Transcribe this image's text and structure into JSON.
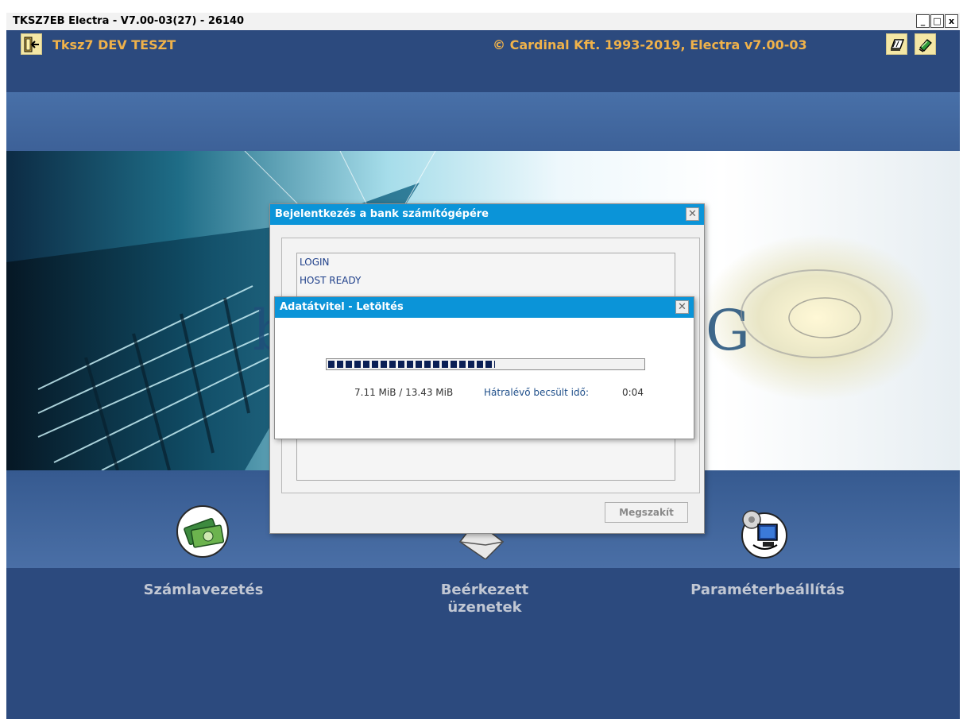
{
  "window": {
    "title": "TKSZ7EB Electra - V7.00-03(27) - 26140",
    "minimize": "_",
    "maximize": "□",
    "close": "x"
  },
  "header": {
    "app_name": "Tksz7 DEV TESZT",
    "copyright": "© Cardinal Kft. 1993-2019, Electra v7.00-03",
    "icons": [
      "exit-icon",
      "book-icon",
      "help-book-icon"
    ]
  },
  "nav": [
    {
      "label": "Számlavezetés",
      "icon": "money-icon"
    },
    {
      "label": "Beérkezett üzenetek",
      "icon": "envelope-icon"
    },
    {
      "label": "Paraméterbeállítás",
      "icon": "settings-computer-icon"
    }
  ],
  "login_dialog": {
    "title": "Bejelentkezés a bank számítógépére",
    "close": "✕",
    "log_lines": [
      "LOGIN",
      "HOST READY"
    ],
    "abort_label": "Megszakít"
  },
  "transfer_dialog": {
    "title": "Adatátvitel - Letöltés",
    "close": "✕",
    "progress": 0.53,
    "size_text": "7.11 MiB / 13.43 MiB",
    "remaining_label": "Hátralévő becsült idő:",
    "remaining_value": "0:04"
  },
  "colors": {
    "header_bg": "#2c4a7e",
    "accent_orange": "#f0b24a",
    "dialog_title_blue": "#0b94d8",
    "progress_fill": "#0a1f55"
  }
}
